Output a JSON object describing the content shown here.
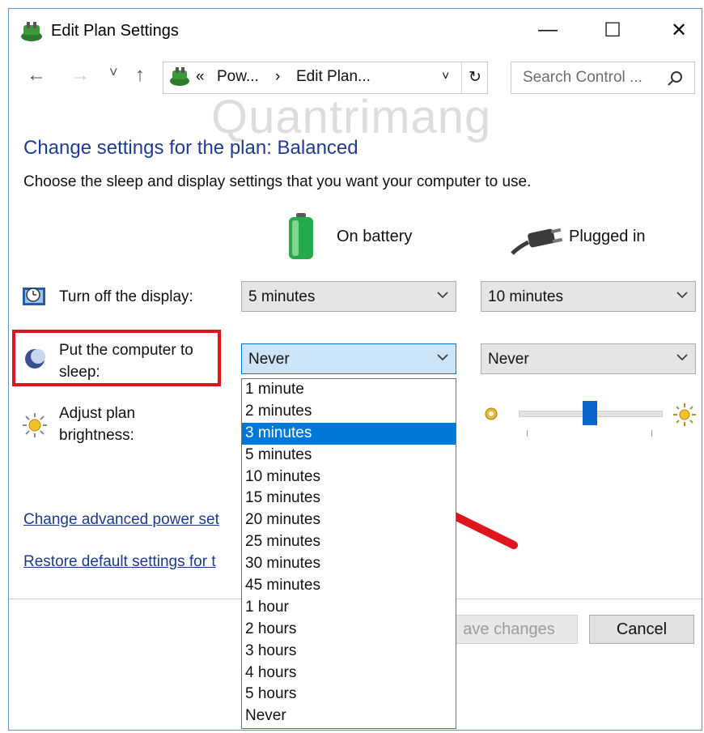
{
  "window": {
    "title": "Edit Plan Settings",
    "controls": {
      "minimize": "—",
      "maximize": "☐",
      "close": "✕"
    }
  },
  "nav": {
    "back": "←",
    "forward": "→",
    "recent": "˅",
    "up": "↑",
    "address": {
      "overflow": "«",
      "crumb1": "Pow...",
      "separator": "›",
      "crumb2": "Edit Plan...",
      "dropdown": "˅",
      "refresh": "↻"
    },
    "search": {
      "placeholder": "Search Control ...",
      "icon": "search-icon"
    }
  },
  "watermark": "Quantrimang",
  "content": {
    "heading": "Change settings for the plan: Balanced",
    "subtext": "Choose the sleep and display settings that you want your computer to use.",
    "columns": {
      "battery": "On battery",
      "plugged": "Plugged in"
    },
    "rows": {
      "display": {
        "label": "Turn off the display:",
        "battery_value": "5 minutes",
        "plugged_value": "10 minutes"
      },
      "sleep": {
        "label_line1": "Put the computer to",
        "label_line2": "sleep:",
        "battery_value": "Never",
        "plugged_value": "Never"
      },
      "brightness": {
        "label_line1": "Adjust plan",
        "label_line2": "brightness:",
        "slider_level_percent": 50
      }
    },
    "links": {
      "advanced": "Change advanced power set",
      "restore": "Restore default settings for t"
    }
  },
  "dropdown": {
    "options": [
      "1 minute",
      "2 minutes",
      "3 minutes",
      "5 minutes",
      "10 minutes",
      "15 minutes",
      "20 minutes",
      "25 minutes",
      "30 minutes",
      "45 minutes",
      "1 hour",
      "2 hours",
      "3 hours",
      "4 hours",
      "5 hours",
      "Never"
    ],
    "highlighted": "3 minutes"
  },
  "footer": {
    "save": "ave changes",
    "cancel": "Cancel"
  },
  "colors": {
    "heading": "#1e3d8f",
    "highlight": "#0078d7",
    "annotation": "#e0141d"
  }
}
